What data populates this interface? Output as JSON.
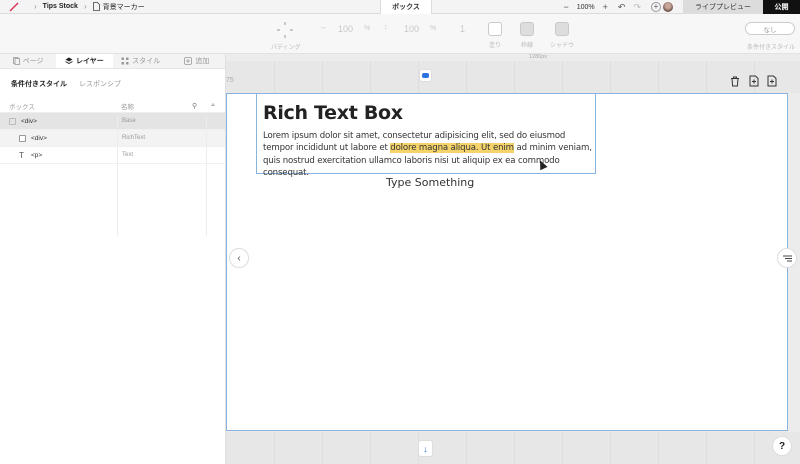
{
  "topbar": {
    "crumb_site": "Tips Stock",
    "crumb_page": "背景マーカー",
    "mode": "ボックス",
    "zoom": "100%",
    "zoom_minus": "−",
    "zoom_plus": "+",
    "preview_label": "ライブプレビュー",
    "publish_label": "公開"
  },
  "toolbar": {
    "padding_label": "パディング",
    "width_value": "100",
    "width_unit": "%",
    "height_value": "100",
    "height_unit": "%",
    "count_value": "1",
    "fill_label": "塗り",
    "border_label": "枠線",
    "shadow_label": "シャドウ",
    "conditional_value": "なし",
    "conditional_label": "条件付きスタイル"
  },
  "left_panel": {
    "tabs": [
      {
        "label": "ページ",
        "icon": "page-icon"
      },
      {
        "label": "レイヤー",
        "icon": "layers-icon"
      },
      {
        "label": "スタイル",
        "icon": "style-icon"
      },
      {
        "label": "追加",
        "icon": "add-icon"
      }
    ],
    "subtab_active": "条件付きスタイル",
    "subtab_other": "レスポンシブ",
    "col_name": "ボックス",
    "col_type": "名称",
    "rows": [
      {
        "name": "<div>",
        "type": "Base"
      },
      {
        "name": "<div>",
        "type": "RichText"
      },
      {
        "name": "<p>",
        "type": "Text"
      }
    ]
  },
  "canvas": {
    "ruler_label": "1280px",
    "side_number": "75",
    "rich_title": "Rich Text Box",
    "para_before": "Lorem ipsum dolor sit amet, consectetur adipisicing elit, sed do eiusmod tempor incididunt ut labore et ",
    "para_highlight": "dolore magna aliqua. Ut enim",
    "para_after": " ad minim veniam, quis nostrud exercitation ullamco laboris nisi ut aliquip ex ea commodo consequat.",
    "placeholder_text": "Type Something",
    "highlight_color": "#f5d36b",
    "accent_color": "#2a73e0"
  },
  "help_label": "?"
}
